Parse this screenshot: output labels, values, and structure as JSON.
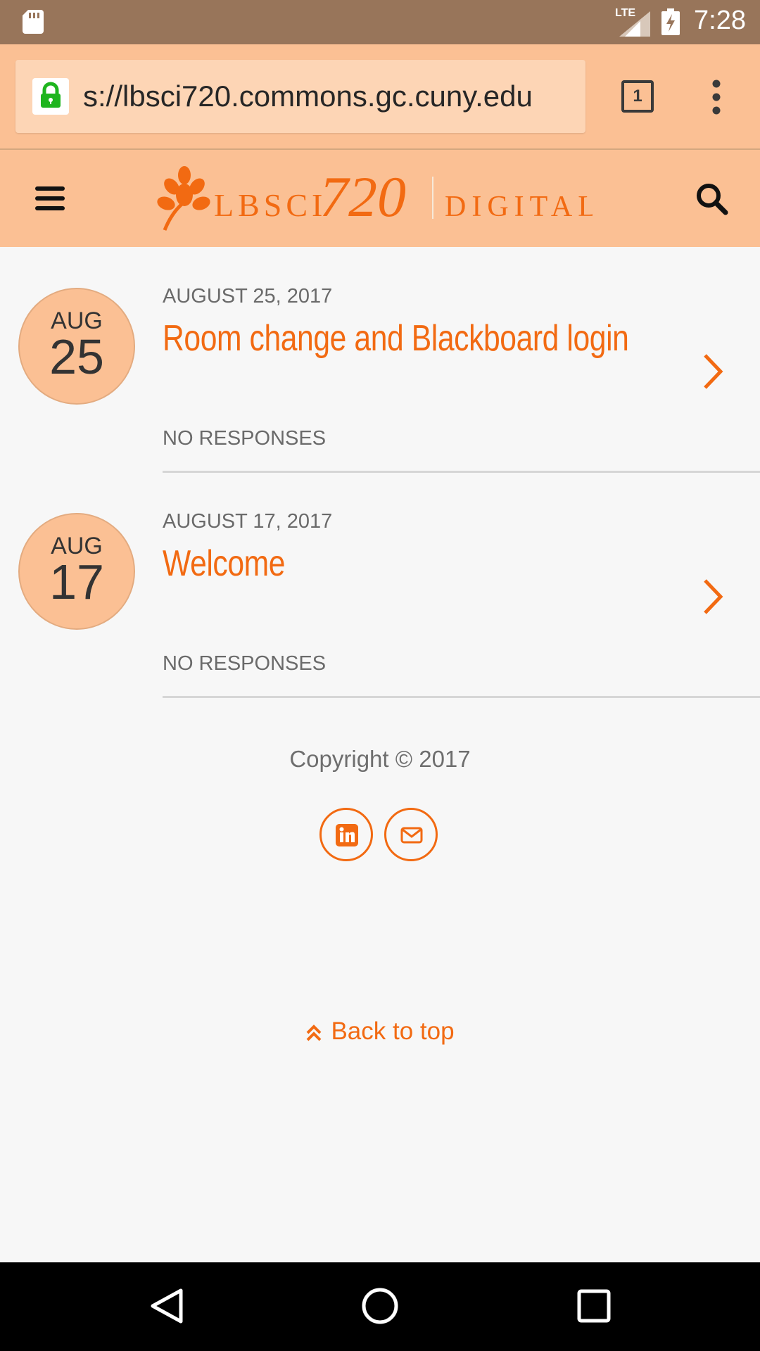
{
  "status_bar": {
    "network": "LTE",
    "time": "7:28",
    "icons": [
      "sd-card-icon",
      "signal-icon",
      "battery-charging-icon"
    ]
  },
  "browser": {
    "url": "s://lbsci720.commons.gc.cuny.edu",
    "tab_count": "1",
    "icons": [
      "lock-icon",
      "tabs-icon",
      "overflow-menu-icon"
    ]
  },
  "site_header": {
    "logo": {
      "prefix": "LBSCI",
      "number": "720",
      "suffix": "DIGITAL"
    },
    "icons": [
      "hamburger-menu-icon",
      "leaf-logo-icon",
      "search-icon"
    ]
  },
  "posts": [
    {
      "month": "AUG",
      "day": "25",
      "date": "AUGUST 25, 2017",
      "title": "Room change and Blackboard login",
      "responses": "NO RESPONSES"
    },
    {
      "month": "AUG",
      "day": "17",
      "date": "AUGUST 17, 2017",
      "title": "Welcome",
      "responses": "NO RESPONSES"
    }
  ],
  "footer": {
    "copyright": "Copyright © 2017",
    "social": [
      "linkedin-icon",
      "envelope-icon"
    ],
    "back_to_top": "Back to top"
  },
  "nav_bar": {
    "icons": [
      "back-triangle-icon",
      "home-circle-icon",
      "recents-square-icon"
    ]
  },
  "colors": {
    "accent": "#f26a12",
    "header_bg": "#fbc094",
    "status_bar_bg": "#98755a",
    "page_bg": "#f7f7f7"
  }
}
